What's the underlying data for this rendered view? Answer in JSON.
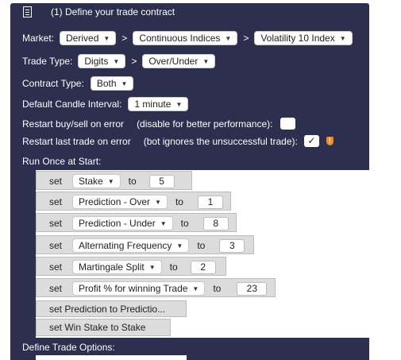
{
  "header": {
    "title": "(1) Define your trade contract",
    "icon": "document-icon"
  },
  "market": {
    "label": "Market:",
    "values": [
      "Derived",
      "Continuous Indices",
      "Volatility 10 Index"
    ]
  },
  "trade_type": {
    "label": "Trade Type:",
    "values": [
      "Digits",
      "Over/Under"
    ]
  },
  "contract_type": {
    "label": "Contract Type:",
    "value": "Both"
  },
  "candle_interval": {
    "label": "Default Candle Interval:",
    "value": "1 minute"
  },
  "restart_buy_sell": {
    "label": "Restart buy/sell on error",
    "hint": "(disable for better performance):",
    "checked": false
  },
  "restart_last_trade": {
    "label": "Restart last trade on error",
    "hint": "(bot ignores the unsuccessful trade):",
    "checked": true,
    "check_glyph": "✓"
  },
  "run_once": {
    "label": "Run Once at Start:",
    "set_word": "set",
    "to_word": "to",
    "blocks": [
      {
        "variable": "Stake",
        "value": "5"
      },
      {
        "variable": "Prediction - Over",
        "value": "1"
      },
      {
        "variable": "Prediction - Under",
        "value": "8"
      },
      {
        "variable": "Alternating Frequency",
        "value": "3"
      },
      {
        "variable": "Martingale Split",
        "value": "2"
      },
      {
        "variable": "Profit % for winning Trade",
        "value": "23"
      }
    ],
    "text_blocks": [
      "set Prediction to Predictio...",
      "set Win Stake to Stake"
    ]
  },
  "define_trade_options": {
    "label": "Define Trade Options:"
  },
  "colors": {
    "panel": "#2c2f4e",
    "block": "#dcdcdc",
    "warning": "#f08a24"
  }
}
